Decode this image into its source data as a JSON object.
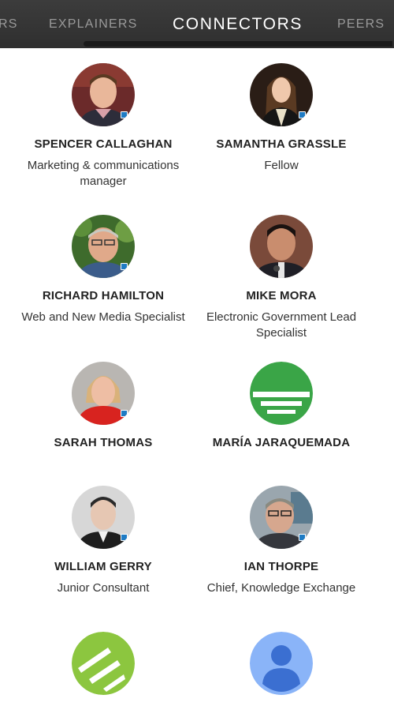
{
  "tabs": {
    "partial_left": "RS",
    "explainers": "EXPLAINERS",
    "connectors": "CONNECTORS",
    "peers": "PEERS"
  },
  "people": [
    {
      "name": "SPENCER CALLAGHAN",
      "role": "Marketing & communications manager",
      "avatar": "photo"
    },
    {
      "name": "SAMANTHA GRASSLE",
      "role": "Fellow",
      "avatar": "photo"
    },
    {
      "name": "RICHARD HAMILTON",
      "role": "Web and New Media Specialist",
      "avatar": "photo"
    },
    {
      "name": "MIKE MORA",
      "role": "Electronic Government Lead Specialist",
      "avatar": "photo"
    },
    {
      "name": "SARAH THOMAS",
      "role": "",
      "avatar": "photo"
    },
    {
      "name": "MARÍA JARAQUEMADA",
      "role": "",
      "avatar": "green-logo"
    },
    {
      "name": "WILLIAM GERRY",
      "role": "Junior Consultant",
      "avatar": "photo"
    },
    {
      "name": "IAN THORPE",
      "role": "Chief, Knowledge Exchange",
      "avatar": "photo"
    },
    {
      "name": "",
      "role": "",
      "avatar": "green-logo-alt"
    },
    {
      "name": "",
      "role": "",
      "avatar": "default-user-icon"
    }
  ],
  "colors": {
    "topbar": "#333333",
    "active_tab": "#ffffff",
    "inactive_tab": "#9a9a9a",
    "brand_green": "#3aa547",
    "lime_green": "#8cc63f",
    "default_avatar_bg": "#8ab4f8",
    "default_avatar_fg": "#3b6fd1"
  }
}
